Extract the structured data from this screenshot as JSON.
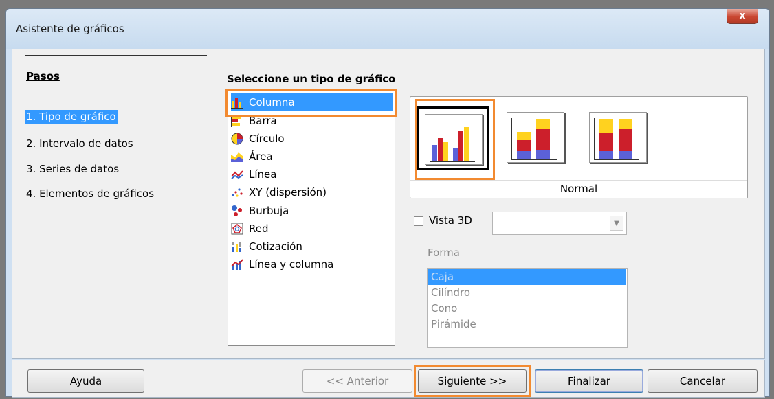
{
  "window": {
    "title": "Asistente de gráficos",
    "close_glyph": "x"
  },
  "steps": {
    "title": "Pasos",
    "items": [
      "1. Tipo de gráfico",
      "2. Intervalo de datos",
      "3. Series de datos",
      "4. Elementos de gráficos"
    ]
  },
  "chart_types": {
    "heading": "Seleccione un tipo de gráfico",
    "items": [
      {
        "label": "Columna",
        "icon": "column-chart-icon"
      },
      {
        "label": "Barra",
        "icon": "bar-chart-icon"
      },
      {
        "label": "Círculo",
        "icon": "pie-chart-icon"
      },
      {
        "label": "Área",
        "icon": "area-chart-icon"
      },
      {
        "label": "Línea",
        "icon": "line-chart-icon"
      },
      {
        "label": "XY (dispersión)",
        "icon": "scatter-chart-icon"
      },
      {
        "label": "Burbuja",
        "icon": "bubble-chart-icon"
      },
      {
        "label": "Red",
        "icon": "net-chart-icon"
      },
      {
        "label": "Cotización",
        "icon": "stock-chart-icon"
      },
      {
        "label": "Línea y columna",
        "icon": "line-column-chart-icon"
      }
    ]
  },
  "variants": {
    "selected_label": "Normal"
  },
  "view3d": {
    "label": "Vista 3D",
    "combo_value": ""
  },
  "shape": {
    "label": "Forma",
    "options": [
      "Caja",
      "Cilíndro",
      "Cono",
      "Pirámide"
    ]
  },
  "buttons": {
    "help": "Ayuda",
    "back": "<< Anterior",
    "next": "Siguiente >>",
    "finish": "Finalizar",
    "cancel": "Cancelar"
  },
  "colors": {
    "accent": "#3399ff",
    "highlight": "#f28a30",
    "red": "#cc1f2b",
    "yellow": "#ffd21f",
    "blue": "#5b61d8"
  }
}
